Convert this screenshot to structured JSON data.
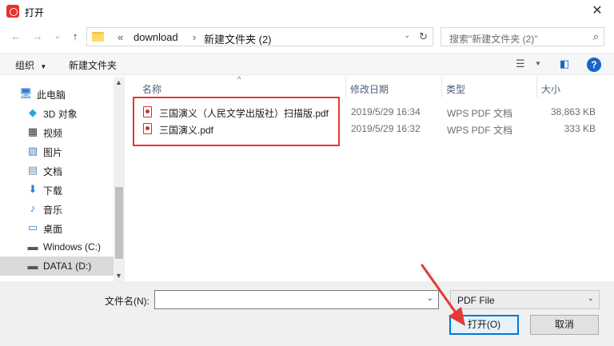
{
  "window": {
    "title": "打开",
    "close_glyph": "✕"
  },
  "nav": {
    "back_glyph": "←",
    "forward_glyph": "→",
    "recent_glyph": "⌄",
    "up_glyph": "↑",
    "breadcrumb": [
      "«",
      "download",
      "›",
      "新建文件夹 (2)"
    ],
    "address_dropdown_glyph": "⌄",
    "refresh_glyph": "↻",
    "search_placeholder": "搜索\"新建文件夹 (2)\"",
    "search_glyph": "⌕"
  },
  "toolbar": {
    "organize_label": "组织",
    "organize_caret": "▼",
    "new_folder_label": "新建文件夹",
    "view_glyph": "☰",
    "view_caret": "▼",
    "pane_glyph": "◧",
    "help_glyph": "?"
  },
  "sidebar": {
    "items": [
      {
        "label": "此电脑",
        "icon": "computer-icon",
        "glyph": "🖥"
      },
      {
        "label": "3D 对象",
        "icon": "3d-objects-icon",
        "glyph": "◆"
      },
      {
        "label": "视频",
        "icon": "video-icon",
        "glyph": "▦"
      },
      {
        "label": "图片",
        "icon": "pictures-icon",
        "glyph": "▨"
      },
      {
        "label": "文档",
        "icon": "documents-icon",
        "glyph": "▤"
      },
      {
        "label": "下载",
        "icon": "downloads-icon",
        "glyph": "⬇"
      },
      {
        "label": "音乐",
        "icon": "music-icon",
        "glyph": "♪"
      },
      {
        "label": "桌面",
        "icon": "desktop-icon",
        "glyph": "▭"
      },
      {
        "label": "Windows (C:)",
        "icon": "drive-c-icon",
        "glyph": "▬"
      },
      {
        "label": "DATA1 (D:)",
        "icon": "drive-d-icon",
        "glyph": "▬"
      }
    ],
    "selected_index": 9,
    "scroll_up_glyph": "▲",
    "scroll_down_glyph": "▼"
  },
  "filelist": {
    "columns": [
      "名称",
      "修改日期",
      "类型",
      "大小"
    ],
    "sort_caret": "^",
    "rows": [
      {
        "name": "三国演义（人民文学出版社）扫描版.pdf",
        "date": "2019/5/29 16:34",
        "type": "WPS PDF 文档",
        "size": "38,863 KB"
      },
      {
        "name": "三国演义.pdf",
        "date": "2019/5/29 16:32",
        "type": "WPS PDF 文档",
        "size": "333 KB"
      }
    ]
  },
  "footer": {
    "filename_label": "文件名(N):",
    "filename_value": "",
    "filename_dd_glyph": "⌄",
    "filetype_value": "PDF File",
    "filetype_dd_glyph": "⌄",
    "open_button": "打开(O)",
    "cancel_button": "取消"
  },
  "colors": {
    "highlight": "#e53935",
    "accent": "#0078d7",
    "help": "#1a64c8"
  }
}
